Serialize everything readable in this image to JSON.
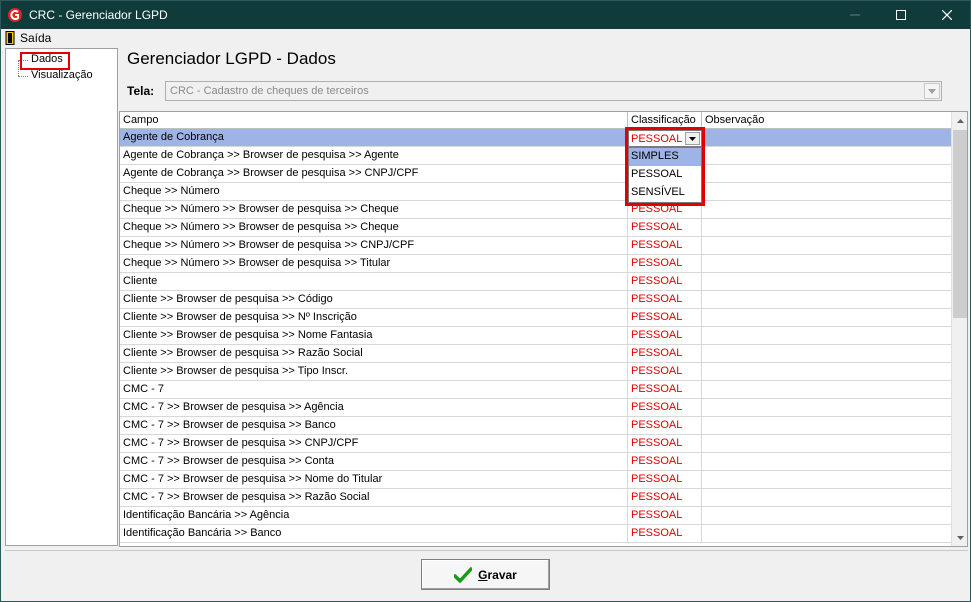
{
  "window": {
    "title": "CRC - Gerenciador LGPD"
  },
  "menu": {
    "exit_label": "Saída"
  },
  "sidebar": {
    "items": [
      {
        "label": "Dados"
      },
      {
        "label": "Visualização"
      }
    ]
  },
  "main": {
    "page_title": "Gerenciador LGPD - Dados",
    "tela_label": "Tela:",
    "tela_value": "CRC - Cadastro de cheques de terceiros"
  },
  "grid": {
    "columns": [
      "Campo",
      "Classificação",
      "Observação"
    ],
    "rows": [
      {
        "campo": "Agente de Cobrança",
        "classificacao": "PESSOAL",
        "observacao": ""
      },
      {
        "campo": "Agente de Cobrança >> Browser de pesquisa >> Agente",
        "classificacao": "SIMPLES",
        "observacao": ""
      },
      {
        "campo": "Agente de Cobrança >> Browser de pesquisa >> CNPJ/CPF",
        "classificacao": "PESSOAL",
        "observacao": ""
      },
      {
        "campo": "Cheque >> Número",
        "classificacao": "SENSÍVEL",
        "observacao": ""
      },
      {
        "campo": "Cheque >> Número >> Browser de pesquisa >> Cheque",
        "classificacao": "PESSOAL",
        "observacao": ""
      },
      {
        "campo": "Cheque >> Número >> Browser de pesquisa >> Cheque",
        "classificacao": "PESSOAL",
        "observacao": ""
      },
      {
        "campo": "Cheque >> Número >> Browser de pesquisa >> CNPJ/CPF",
        "classificacao": "PESSOAL",
        "observacao": ""
      },
      {
        "campo": "Cheque >> Número >> Browser de pesquisa >> Titular",
        "classificacao": "PESSOAL",
        "observacao": ""
      },
      {
        "campo": "Cliente",
        "classificacao": "PESSOAL",
        "observacao": ""
      },
      {
        "campo": "Cliente >> Browser de pesquisa >> Código",
        "classificacao": "PESSOAL",
        "observacao": ""
      },
      {
        "campo": "Cliente >> Browser de pesquisa >> Nº Inscrição",
        "classificacao": "PESSOAL",
        "observacao": ""
      },
      {
        "campo": "Cliente >> Browser de pesquisa >> Nome Fantasia",
        "classificacao": "PESSOAL",
        "observacao": ""
      },
      {
        "campo": "Cliente >> Browser de pesquisa >> Razão Social",
        "classificacao": "PESSOAL",
        "observacao": ""
      },
      {
        "campo": "Cliente >> Browser de pesquisa >> Tipo Inscr.",
        "classificacao": "PESSOAL",
        "observacao": ""
      },
      {
        "campo": "CMC - 7",
        "classificacao": "PESSOAL",
        "observacao": ""
      },
      {
        "campo": "CMC - 7 >> Browser de pesquisa >> Agência",
        "classificacao": "PESSOAL",
        "observacao": ""
      },
      {
        "campo": "CMC - 7 >> Browser de pesquisa >> Banco",
        "classificacao": "PESSOAL",
        "observacao": ""
      },
      {
        "campo": "CMC - 7 >> Browser de pesquisa >> CNPJ/CPF",
        "classificacao": "PESSOAL",
        "observacao": ""
      },
      {
        "campo": "CMC - 7 >> Browser de pesquisa >> Conta",
        "classificacao": "PESSOAL",
        "observacao": ""
      },
      {
        "campo": "CMC - 7 >> Browser de pesquisa >> Nome do Titular",
        "classificacao": "PESSOAL",
        "observacao": ""
      },
      {
        "campo": "CMC - 7 >> Browser de pesquisa >> Razão Social",
        "classificacao": "PESSOAL",
        "observacao": ""
      },
      {
        "campo": "Identificação Bancária >> Agência",
        "classificacao": "PESSOAL",
        "observacao": ""
      },
      {
        "campo": "Identificação Bancária >> Banco",
        "classificacao": "PESSOAL",
        "observacao": ""
      }
    ],
    "editor": {
      "current_value": "PESSOAL",
      "options": [
        "SIMPLES",
        "PESSOAL",
        "SENSÍVEL"
      ],
      "active_option": "SIMPLES"
    }
  },
  "footer": {
    "save_label": "Gravar"
  },
  "colors": {
    "titlebar": "#0f3b3b",
    "classification_text": "#e00000",
    "selection": "#9fb4e6",
    "annotation_box": "#e00000"
  },
  "icons": {
    "app": "crc-logo-icon",
    "exit": "door-exit-icon",
    "save": "checkmark-icon"
  }
}
